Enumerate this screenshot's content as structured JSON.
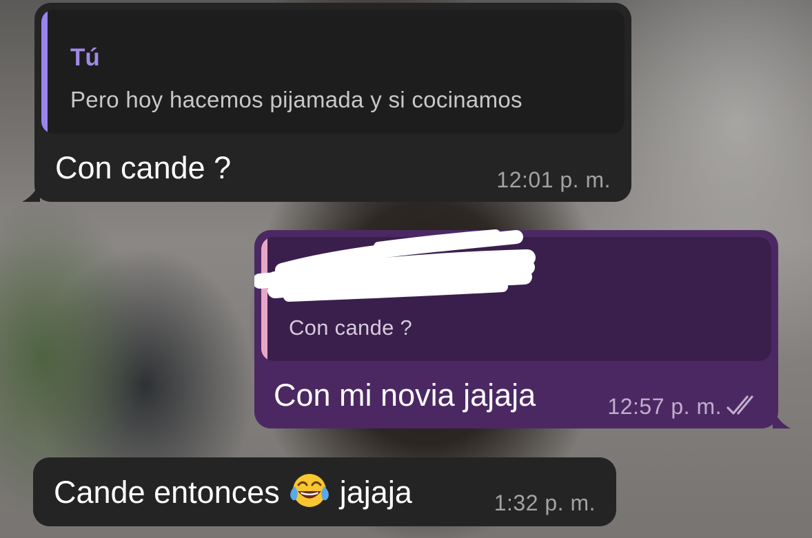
{
  "messages": [
    {
      "direction": "incoming",
      "reply": {
        "sender": "Tú",
        "text": "Pero hoy hacemos pijamada y si cocinamos"
      },
      "text": "Con cande ?",
      "time": "12:01 p. m."
    },
    {
      "direction": "outgoing",
      "reply": {
        "sender": "",
        "text": "Con cande ?"
      },
      "text": "Con mi novia jajaja",
      "time": "12:57 p. m.",
      "status_icon": "double-check-icon"
    },
    {
      "direction": "incoming",
      "text_before": "Cande entonces",
      "emoji": "tears-of-joy-emoji",
      "text_after": "jajaja",
      "time": "1:32 p. m."
    }
  ],
  "colors": {
    "incoming_bubble": "#242424",
    "outgoing_bubble": "#4c2863",
    "incoming_reply_bar": "#9a84ee",
    "outgoing_reply_bar": "#e7a8c6",
    "reply_sender": "#a08ae6"
  }
}
